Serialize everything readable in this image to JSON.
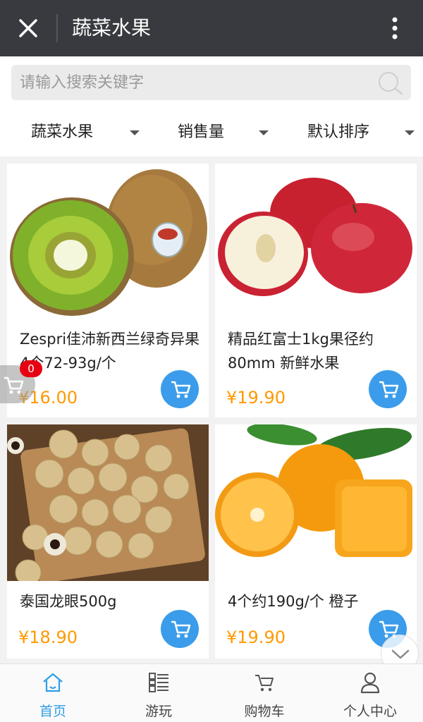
{
  "header": {
    "title": "蔬菜水果",
    "close_icon": "close-icon",
    "more_icon": "more-vertical-icon"
  },
  "search": {
    "placeholder": "请输入搜索关键字",
    "value": ""
  },
  "filters": [
    {
      "label": "蔬菜水果"
    },
    {
      "label": "销售量"
    },
    {
      "label": "默认排序"
    }
  ],
  "products": [
    {
      "name": "Zespri佳沛新西兰绿奇异果4个72-93g/个",
      "price": "¥16.00",
      "image": "kiwi-fruit"
    },
    {
      "name": "精品红富士1kg果径约80mm 新鲜水果",
      "price": "¥19.90",
      "image": "red-apples"
    },
    {
      "name": "泰国龙眼500g",
      "price": "¥18.90",
      "image": "longan"
    },
    {
      "name": "4个约190g/个 橙子",
      "price": "¥19.90",
      "image": "oranges"
    }
  ],
  "floating_cart": {
    "count": "0"
  },
  "tabs": [
    {
      "label": "首页",
      "icon": "home-icon",
      "active": true
    },
    {
      "label": "游玩",
      "icon": "list-icon",
      "active": false
    },
    {
      "label": "购物车",
      "icon": "cart-icon",
      "active": false
    },
    {
      "label": "个人中心",
      "icon": "user-icon",
      "active": false
    }
  ],
  "colors": {
    "accent": "#2f9ee6",
    "price": "#ff9900",
    "header_bg": "#393a3f",
    "badge": "#e60012"
  }
}
